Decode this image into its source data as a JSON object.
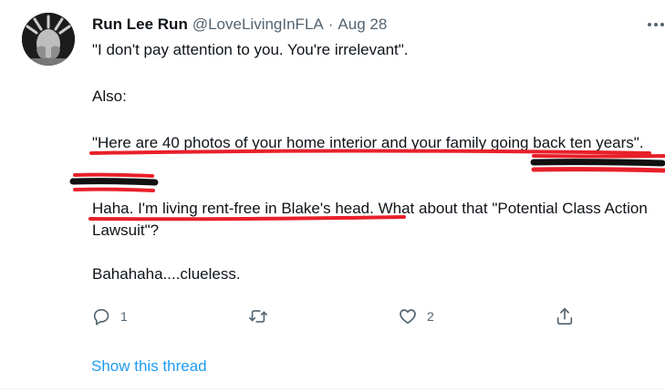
{
  "tweet": {
    "author_name": "Run Lee Run",
    "handle": "@LoveLivingInFLA",
    "separator": "·",
    "date": "Aug 28",
    "paragraphs": [
      "\"I don't pay attention to you. You're irrelevant\".",
      "Also:",
      "\"Here are 40 photos of your home interior and your family going back ten years\".",
      "Haha. I'm living rent-free in Blake's head. What about that \"Potential Class Action Lawsuit\"?",
      "Bahahaha....clueless."
    ],
    "actions": {
      "reply_count": "1",
      "retweet_count": "",
      "like_count": "2"
    },
    "show_thread_label": "Show this thread"
  },
  "icons": {
    "more": "more-dots-icon",
    "reply": "reply-icon",
    "retweet": "retweet-icon",
    "like": "heart-icon",
    "share": "share-icon"
  },
  "colors": {
    "text": "#0f1419",
    "muted": "#536471",
    "link": "#1d9bf0",
    "annotation_red": "#e8202a",
    "annotation_black": "#111111"
  }
}
